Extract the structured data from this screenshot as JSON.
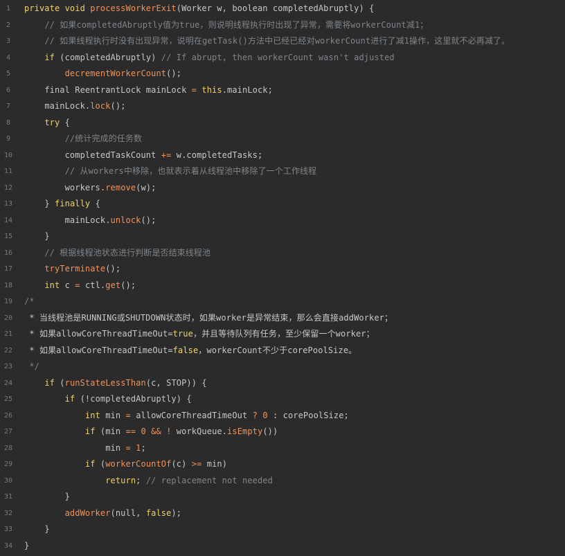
{
  "lines": [
    {
      "n": "1",
      "indent": 0,
      "tokens": [
        {
          "t": "private void ",
          "c": "kw"
        },
        {
          "t": "processWorkerExit",
          "c": "fn"
        },
        {
          "t": "(Worker w, boolean completedAbruptly) {",
          "c": "pl"
        }
      ]
    },
    {
      "n": "2",
      "indent": 4,
      "tokens": [
        {
          "t": "// 如果completedAbruptly值为true，则说明线程执行时出现了异常，需要将workerCount减1；",
          "c": "cm"
        }
      ]
    },
    {
      "n": "3",
      "indent": 4,
      "tokens": [
        {
          "t": "// 如果线程执行时没有出现异常，说明在getTask()方法中已经已经对workerCount进行了减1操作，这里就不必再减了。",
          "c": "cm"
        }
      ]
    },
    {
      "n": "4",
      "indent": 4,
      "tokens": [
        {
          "t": "if ",
          "c": "kw"
        },
        {
          "t": "(completedAbruptly) ",
          "c": "pl"
        },
        {
          "t": "// If abrupt, then workerCount wasn't adjusted",
          "c": "cm"
        }
      ]
    },
    {
      "n": "5",
      "indent": 8,
      "tokens": [
        {
          "t": "decrementWorkerCount",
          "c": "fn"
        },
        {
          "t": "();",
          "c": "pl"
        }
      ]
    },
    {
      "n": "6",
      "indent": 4,
      "tokens": [
        {
          "t": "final ReentrantLock mainLock ",
          "c": "pl"
        },
        {
          "t": "= ",
          "c": "op"
        },
        {
          "t": "this",
          "c": "kw"
        },
        {
          "t": ".mainLock;",
          "c": "pl"
        }
      ]
    },
    {
      "n": "7",
      "indent": 4,
      "tokens": [
        {
          "t": "mainLock.",
          "c": "pl"
        },
        {
          "t": "lock",
          "c": "fn"
        },
        {
          "t": "();",
          "c": "pl"
        }
      ]
    },
    {
      "n": "8",
      "indent": 4,
      "tokens": [
        {
          "t": "try ",
          "c": "kw"
        },
        {
          "t": "{",
          "c": "pl"
        }
      ]
    },
    {
      "n": "9",
      "indent": 8,
      "tokens": [
        {
          "t": "//统计完成的任务数",
          "c": "cm"
        }
      ]
    },
    {
      "n": "10",
      "indent": 8,
      "tokens": [
        {
          "t": "completedTaskCount ",
          "c": "pl"
        },
        {
          "t": "+= ",
          "c": "op"
        },
        {
          "t": "w.completedTasks;",
          "c": "pl"
        }
      ]
    },
    {
      "n": "11",
      "indent": 8,
      "tokens": [
        {
          "t": "// 从workers中移除，也就表示着从线程池中移除了一个工作线程",
          "c": "cm"
        }
      ]
    },
    {
      "n": "12",
      "indent": 8,
      "tokens": [
        {
          "t": "workers.",
          "c": "pl"
        },
        {
          "t": "remove",
          "c": "fn"
        },
        {
          "t": "(w);",
          "c": "pl"
        }
      ]
    },
    {
      "n": "13",
      "indent": 4,
      "tokens": [
        {
          "t": "} ",
          "c": "pl"
        },
        {
          "t": "finally ",
          "c": "kw"
        },
        {
          "t": "{",
          "c": "pl"
        }
      ]
    },
    {
      "n": "14",
      "indent": 8,
      "tokens": [
        {
          "t": "mainLock.",
          "c": "pl"
        },
        {
          "t": "unlock",
          "c": "fn"
        },
        {
          "t": "();",
          "c": "pl"
        }
      ]
    },
    {
      "n": "15",
      "indent": 4,
      "tokens": [
        {
          "t": "}",
          "c": "pl"
        }
      ]
    },
    {
      "n": "16",
      "indent": 4,
      "tokens": [
        {
          "t": "// 根据线程池状态进行判断是否结束线程池",
          "c": "cm"
        }
      ]
    },
    {
      "n": "17",
      "indent": 4,
      "tokens": [
        {
          "t": "tryTerminate",
          "c": "fn"
        },
        {
          "t": "();",
          "c": "pl"
        }
      ]
    },
    {
      "n": "18",
      "indent": 4,
      "tokens": [
        {
          "t": "int ",
          "c": "kw"
        },
        {
          "t": "c ",
          "c": "pl"
        },
        {
          "t": "= ",
          "c": "op"
        },
        {
          "t": "ctl.",
          "c": "pl"
        },
        {
          "t": "get",
          "c": "fn"
        },
        {
          "t": "();",
          "c": "pl"
        }
      ]
    },
    {
      "n": "19",
      "indent": 0,
      "tokens": [
        {
          "t": "/*",
          "c": "cm"
        }
      ]
    },
    {
      "n": "20",
      "indent": 1,
      "tokens": [
        {
          "t": "* 当线程池是RUNNING或SHUTDOWN状态时，如果worker是异常结束，那么会直接addWorker；",
          "c": "pl"
        }
      ]
    },
    {
      "n": "21",
      "indent": 1,
      "tokens": [
        {
          "t": "* 如果allowCoreThreadTimeOut=",
          "c": "pl"
        },
        {
          "t": "true",
          "c": "kw"
        },
        {
          "t": "，并且等待队列有任务，至少保留一个worker；",
          "c": "pl"
        }
      ]
    },
    {
      "n": "22",
      "indent": 1,
      "tokens": [
        {
          "t": "* 如果allowCoreThreadTimeOut=",
          "c": "pl"
        },
        {
          "t": "false",
          "c": "kw"
        },
        {
          "t": "，workerCount不少于corePoolSize。",
          "c": "pl"
        }
      ]
    },
    {
      "n": "23",
      "indent": 1,
      "tokens": [
        {
          "t": "*/",
          "c": "cm"
        }
      ]
    },
    {
      "n": "24",
      "indent": 4,
      "tokens": [
        {
          "t": "if ",
          "c": "kw"
        },
        {
          "t": "(",
          "c": "pl"
        },
        {
          "t": "runStateLessThan",
          "c": "fn"
        },
        {
          "t": "(c, STOP)) {",
          "c": "pl"
        }
      ]
    },
    {
      "n": "25",
      "indent": 8,
      "tokens": [
        {
          "t": "if ",
          "c": "kw"
        },
        {
          "t": "(!completedAbruptly) {",
          "c": "pl"
        }
      ]
    },
    {
      "n": "26",
      "indent": 12,
      "tokens": [
        {
          "t": "int ",
          "c": "kw"
        },
        {
          "t": "min ",
          "c": "pl"
        },
        {
          "t": "= ",
          "c": "op"
        },
        {
          "t": "allowCoreThreadTimeOut ",
          "c": "pl"
        },
        {
          "t": "? ",
          "c": "op"
        },
        {
          "t": "0 ",
          "c": "num"
        },
        {
          "t": ": corePoolSize;",
          "c": "pl"
        }
      ]
    },
    {
      "n": "27",
      "indent": 12,
      "tokens": [
        {
          "t": "if ",
          "c": "kw"
        },
        {
          "t": "(min ",
          "c": "pl"
        },
        {
          "t": "== ",
          "c": "op"
        },
        {
          "t": "0 ",
          "c": "num"
        },
        {
          "t": "&& ",
          "c": "op"
        },
        {
          "t": "! ",
          "c": "op"
        },
        {
          "t": "workQueue.",
          "c": "pl"
        },
        {
          "t": "isEmpty",
          "c": "fn"
        },
        {
          "t": "())",
          "c": "pl"
        }
      ]
    },
    {
      "n": "28",
      "indent": 16,
      "tokens": [
        {
          "t": "min ",
          "c": "pl"
        },
        {
          "t": "= ",
          "c": "op"
        },
        {
          "t": "1",
          "c": "num"
        },
        {
          "t": ";",
          "c": "pl"
        }
      ]
    },
    {
      "n": "29",
      "indent": 12,
      "tokens": [
        {
          "t": "if ",
          "c": "kw"
        },
        {
          "t": "(",
          "c": "pl"
        },
        {
          "t": "workerCountOf",
          "c": "fn"
        },
        {
          "t": "(c) ",
          "c": "pl"
        },
        {
          "t": ">= ",
          "c": "op"
        },
        {
          "t": "min)",
          "c": "pl"
        }
      ]
    },
    {
      "n": "30",
      "indent": 16,
      "tokens": [
        {
          "t": "return",
          "c": "kw"
        },
        {
          "t": "; ",
          "c": "pl"
        },
        {
          "t": "// replacement not needed",
          "c": "cm"
        }
      ]
    },
    {
      "n": "31",
      "indent": 8,
      "tokens": [
        {
          "t": "}",
          "c": "pl"
        }
      ]
    },
    {
      "n": "32",
      "indent": 8,
      "tokens": [
        {
          "t": "addWorker",
          "c": "fn"
        },
        {
          "t": "(null, ",
          "c": "pl"
        },
        {
          "t": "false",
          "c": "kw"
        },
        {
          "t": ");",
          "c": "pl"
        }
      ]
    },
    {
      "n": "33",
      "indent": 4,
      "tokens": [
        {
          "t": "}",
          "c": "pl"
        }
      ]
    },
    {
      "n": "34",
      "indent": 0,
      "tokens": [
        {
          "t": "}",
          "c": "pl"
        }
      ]
    }
  ]
}
